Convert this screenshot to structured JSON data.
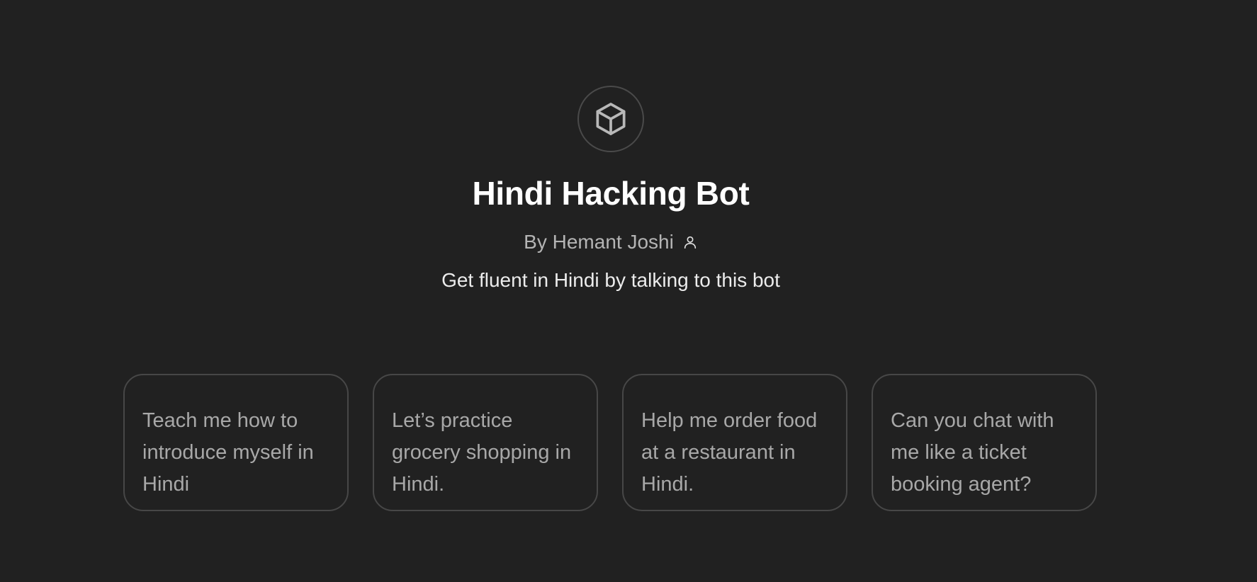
{
  "bot": {
    "avatar_icon": "cube-icon",
    "name": "Hindi Hacking Bot",
    "byline": "By Hemant Joshi",
    "author_icon": "person-icon",
    "description": "Get fluent in Hindi by talking to this bot"
  },
  "conversation_starters": [
    {
      "label": "Teach me how to introduce myself in Hindi"
    },
    {
      "label": "Let’s practice grocery shopping in Hindi."
    },
    {
      "label": "Help me order food at a restaurant in Hindi."
    },
    {
      "label": "Can you chat with me like a ticket booking agent?"
    }
  ],
  "colors": {
    "background": "#212121",
    "title": "#ffffff",
    "byline": "#b4b4b4",
    "starter_text": "#a8a8a8",
    "starter_border": "#474747"
  }
}
